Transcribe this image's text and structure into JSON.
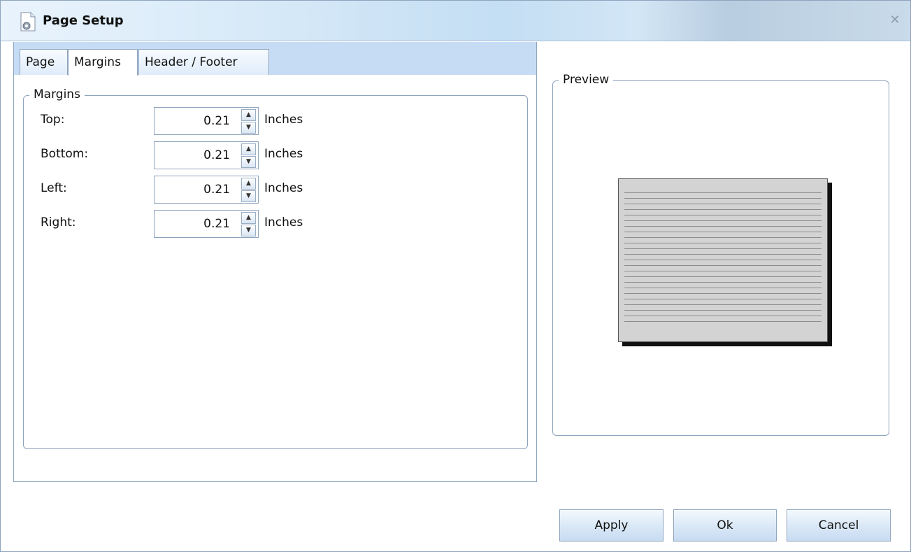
{
  "window": {
    "title": "Page Setup",
    "icon": "page-setup-icon",
    "close_icon": "close-icon",
    "close_glyph": "✕"
  },
  "tabs": [
    {
      "label": "Page",
      "active": false
    },
    {
      "label": "Margins",
      "active": true
    },
    {
      "label": "Header / Footer",
      "active": false
    }
  ],
  "margins": {
    "legend": "Margins",
    "rows": [
      {
        "label": "Top:",
        "value": "0.21",
        "unit": "Inches"
      },
      {
        "label": "Bottom:",
        "value": "0.21",
        "unit": "Inches"
      },
      {
        "label": "Left:",
        "value": "0.21",
        "unit": "Inches"
      },
      {
        "label": "Right:",
        "value": "0.21",
        "unit": "Inches"
      }
    ]
  },
  "preview": {
    "legend": "Preview"
  },
  "buttons": {
    "apply": "Apply",
    "ok": "Ok",
    "cancel": "Cancel"
  },
  "spin_glyphs": {
    "up": "▲",
    "down": "▼"
  }
}
